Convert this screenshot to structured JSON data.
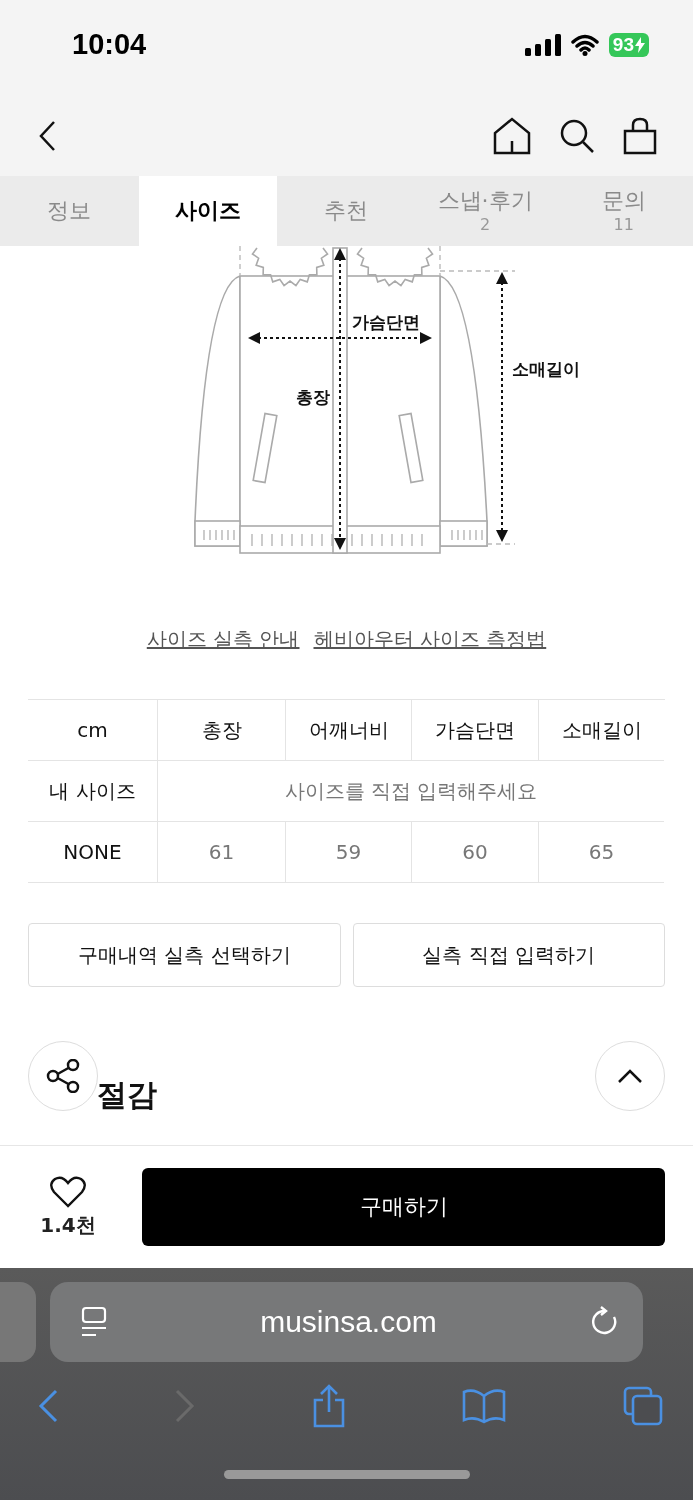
{
  "status_bar": {
    "time": "10:04",
    "battery": "93"
  },
  "tabs": [
    {
      "label": "정보",
      "selected": false
    },
    {
      "label": "사이즈",
      "selected": true
    },
    {
      "label": "추천",
      "selected": false
    },
    {
      "label": "스냅·후기",
      "count": "2",
      "selected": false
    },
    {
      "label": "문의",
      "count": "11",
      "selected": false
    }
  ],
  "diagram": {
    "chest_label": "가슴단면",
    "length_label": "총장",
    "sleeve_label": "소매길이"
  },
  "links": [
    "사이즈 실측 안내",
    "헤비아우터 사이즈 측정법"
  ],
  "size_table": {
    "columns": [
      "cm",
      "총장",
      "어깨너비",
      "가슴단면",
      "소매길이"
    ],
    "my_size": {
      "label": "내 사이즈",
      "placeholder": "사이즈를 직접 입력해주세요"
    },
    "rows": [
      {
        "cells": [
          "NONE",
          "61",
          "59",
          "60",
          "65"
        ]
      }
    ]
  },
  "action_buttons": [
    "구매내역 실측 선택하기",
    "실측 직접 입력하기"
  ],
  "section_heading": "절감",
  "bottom_bar": {
    "likes": "1.4천",
    "buy_button": "구매하기"
  },
  "browser": {
    "url": "musinsa.com"
  }
}
